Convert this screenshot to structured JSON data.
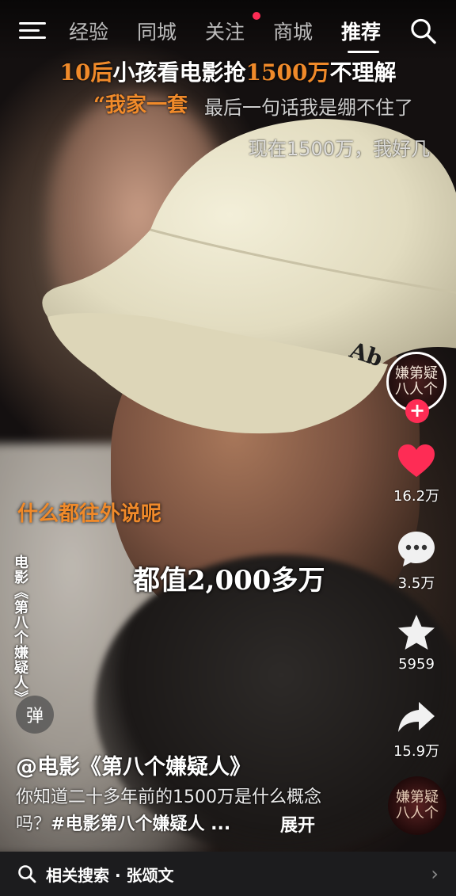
{
  "nav": {
    "tabs": [
      {
        "label": "经验",
        "active": false
      },
      {
        "label": "同城",
        "active": false
      },
      {
        "label": "关注",
        "active": false,
        "has_dot": true
      },
      {
        "label": "商城",
        "active": false
      },
      {
        "label": "推荐",
        "active": true
      }
    ]
  },
  "captions": {
    "title_part1": "10后",
    "title_part2": "小孩看电影抢",
    "title_part3": "1500万",
    "title_part4": "不理解",
    "line2": "“我家一套",
    "danmu1": "最后一句话我是绷不住了",
    "danmu2": "现在1500万，我好几",
    "sub_orange": "什么都往外说呢",
    "sub_white": "都值2,000多万",
    "vertical_label": "电影《第八个嫌疑人》"
  },
  "danmaku_button": "弹",
  "rail": {
    "avatar_text": "嫌第疑八人个",
    "follow": "+",
    "likes": "16.2万",
    "comments": "3.5万",
    "favorites": "5959",
    "shares": "15.9万",
    "music_text": "嫌第疑八人个"
  },
  "post": {
    "author": "@电影《第八个嫌疑人》",
    "desc_text": "你知道二十多年前的1500万是什么概念吗？",
    "desc_tag": "#电影第八个嫌疑人 ...",
    "expand": "展开"
  },
  "related": {
    "text": "相关搜索 · 张颂文"
  },
  "colors": {
    "accent_red": "#fe2c55",
    "caption_orange": "#f08a2a",
    "bar_bg": "#1c1c1e"
  }
}
